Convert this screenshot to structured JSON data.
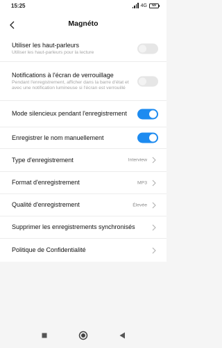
{
  "status_bar": {
    "time": "15:25",
    "network": "4G",
    "battery": "69"
  },
  "header": {
    "title": "Magnéto"
  },
  "settings": [
    {
      "title": "Utiliser les haut-parleurs",
      "subtitle": "Utiliser les haut-parleurs pour la lecture",
      "control": "toggle",
      "state": "off"
    },
    {
      "title": "Notifications à l'écran de verrouillage",
      "subtitle": "Pendant l'enregistrement, afficher dans la barre d'état et avec une notification lumineuse si l'écran est verrouillé",
      "control": "toggle",
      "state": "off"
    },
    {
      "title": "Mode silencieux pendant l'enregistrement",
      "control": "toggle",
      "state": "on"
    },
    {
      "title": "Enregistrer le nom manuellement",
      "control": "toggle",
      "state": "on"
    },
    {
      "title": "Type d'enregistrement",
      "value": "Interview",
      "control": "chevron"
    },
    {
      "title": "Format d'enregistrement",
      "value": "MP3",
      "control": "chevron"
    },
    {
      "title": "Qualité d'enregistrement",
      "value": "Élevée",
      "control": "chevron"
    },
    {
      "title": "Supprimer les enregistrements synchronisés",
      "control": "chevron"
    },
    {
      "title": "Politique de Confidentialité",
      "control": "chevron"
    }
  ],
  "colors": {
    "toggle_on": "#1d8bf0",
    "toggle_off": "#e6e6e6"
  },
  "nav_bar": {
    "icons": [
      "square-icon",
      "circle-home-icon",
      "triangle-back-icon"
    ]
  }
}
